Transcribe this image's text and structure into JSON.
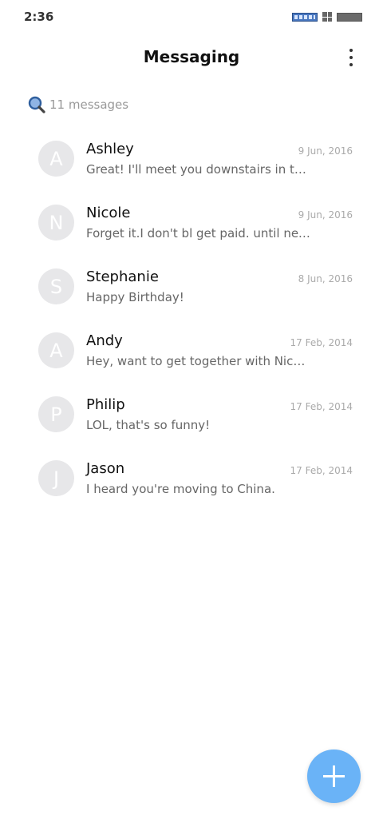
{
  "status_bar": {
    "time": "2:36"
  },
  "header": {
    "title": "Messaging"
  },
  "search": {
    "text": "11 messages"
  },
  "conversations": [
    {
      "initial": "A",
      "name": "Ashley",
      "date": "9 Jun, 2016",
      "preview": "Great! I'll meet you downstairs in ten minutes."
    },
    {
      "initial": "N",
      "name": "Nicole",
      "date": "9 Jun, 2016",
      "preview": "Forget it.I don't bl get paid. until next Friday."
    },
    {
      "initial": "S",
      "name": "Stephanie",
      "date": "8 Jun, 2016",
      "preview": "Happy Birthday!"
    },
    {
      "initial": "A",
      "name": "Andy",
      "date": "17 Feb, 2014",
      "preview": "Hey, want to get together with Nicole tonight?"
    },
    {
      "initial": "P",
      "name": "Philip",
      "date": "17 Feb, 2014",
      "preview": "LOL, that's so funny!"
    },
    {
      "initial": "J",
      "name": "Jason",
      "date": "17 Feb, 2014",
      "preview": "I heard you're moving to China."
    }
  ],
  "colors": {
    "fab": "#6ab3f7",
    "avatar_bg": "#e7e7e9"
  },
  "icons": {
    "menu": "more-vertical-icon",
    "search": "search-icon",
    "compose": "plus-icon"
  }
}
